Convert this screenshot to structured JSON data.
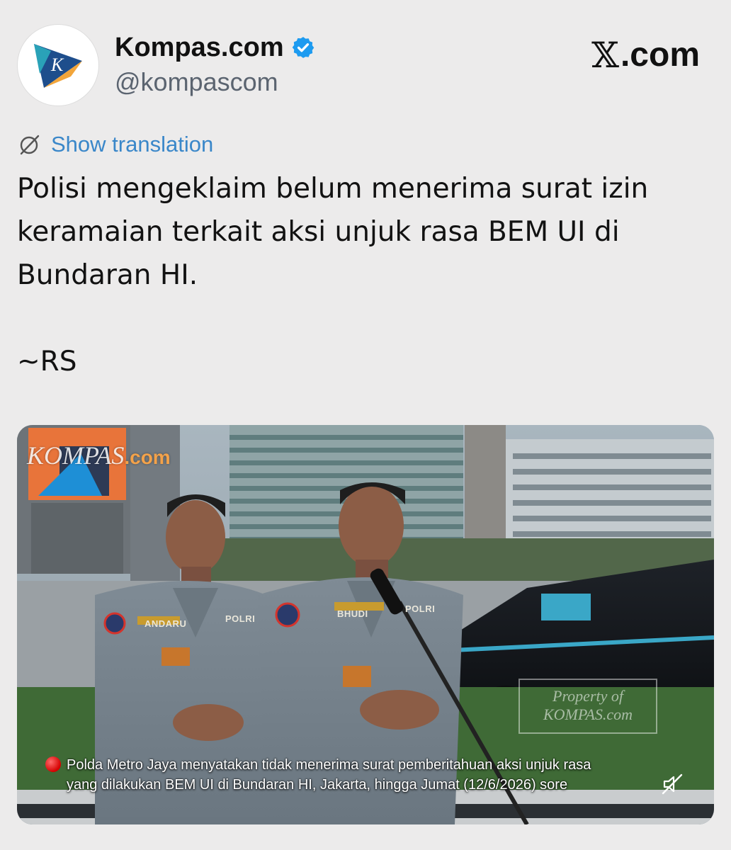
{
  "account": {
    "display_name": "Kompas.com",
    "handle": "@kompascom",
    "verified": true,
    "avatar_letter": "K",
    "avatar_colors": {
      "blue": "#1e4e8c",
      "orange": "#f2a53a",
      "teal": "#2aa2b8"
    }
  },
  "brand": {
    "x_glyph": "𝕏",
    "text": ".com"
  },
  "translation": {
    "label": "Show translation",
    "icon": "translate-globe-icon"
  },
  "tweet": {
    "lines": [
      "Polisi mengeklaim belum menerima surat izin",
      "keramaian terkait aksi unjuk rasa BEM UI di",
      "Bundaran HI."
    ],
    "signature": "~RS"
  },
  "media": {
    "watermark_top": {
      "main": "KOMPAS",
      "suffix": ".com"
    },
    "watermark_bottom": {
      "line1": "Property of",
      "line2": "KOMPAS.com"
    },
    "name_tags": {
      "left": "ANDARU",
      "left_badge": "POLRI",
      "right": "BHUDI",
      "right_badge": "POLRI"
    },
    "caption": [
      "Polda Metro Jaya menyatakan tidak menerima surat pemberitahuan aksi unjuk rasa",
      "yang dilakukan BEM UI di Bundaran HI, Jakarta, hingga Jumat (12/6/2026) sore"
    ],
    "mute_icon": "muted-speaker-icon"
  },
  "colors": {
    "background": "#ecebeb",
    "link": "#3a87c9",
    "verified": "#1d9bf0",
    "handle": "#5b6470"
  }
}
